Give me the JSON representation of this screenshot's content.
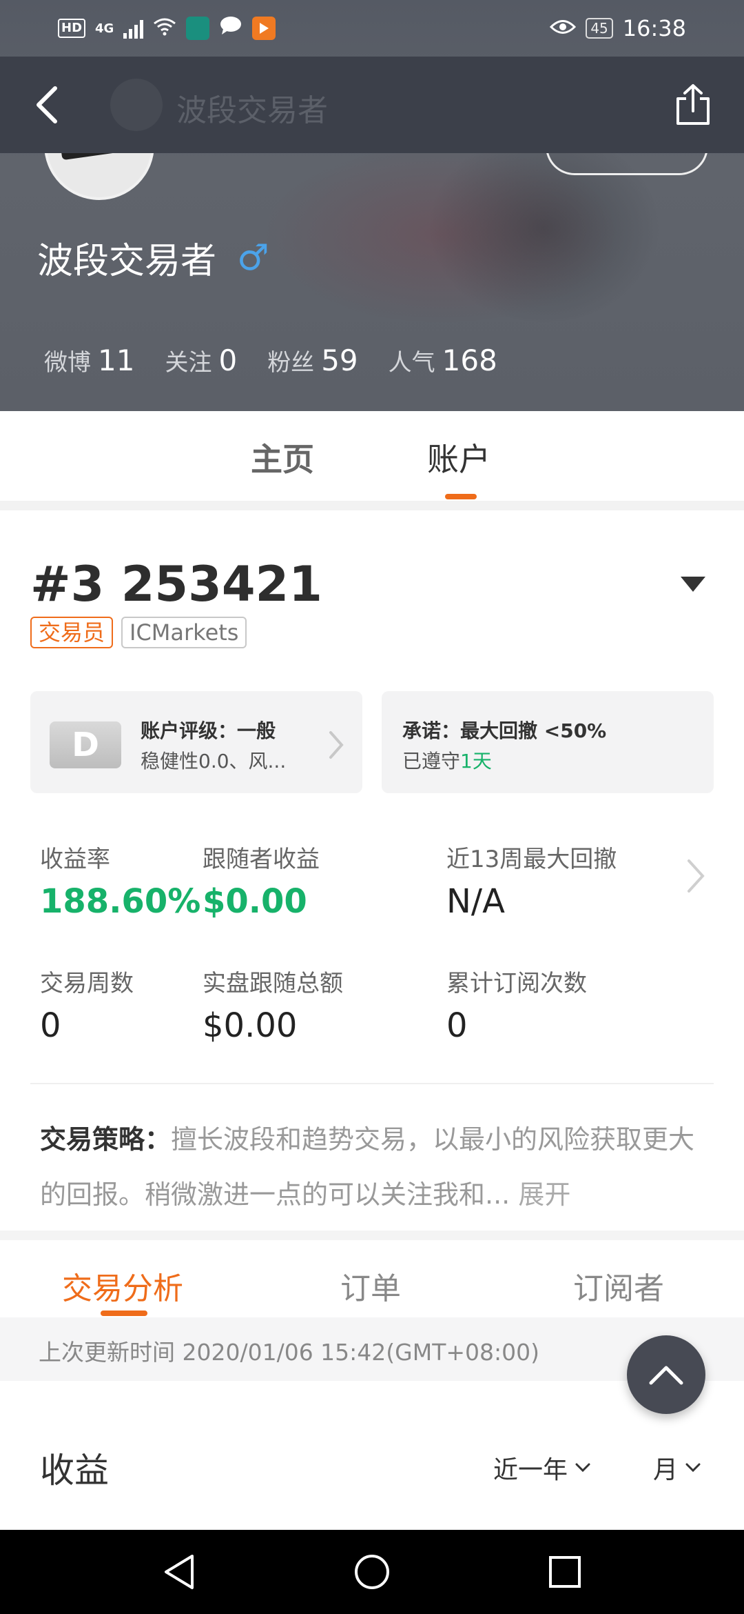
{
  "status_bar": {
    "hd": "HD",
    "network": "4G",
    "time": "16:38",
    "battery": "45"
  },
  "topbar": {
    "title": "波段交易者"
  },
  "profile": {
    "name": "波段交易者",
    "gender_symbol": "♂",
    "stats": [
      {
        "label": "微博",
        "value": "11"
      },
      {
        "label": "关注",
        "value": "0"
      },
      {
        "label": "粉丝",
        "value": "59"
      },
      {
        "label": "人气",
        "value": "168"
      }
    ]
  },
  "profile_tabs": {
    "home": "主页",
    "account": "账户"
  },
  "account": {
    "number": "#3 253421",
    "role_badge": "交易员",
    "broker_badge": "ICMarkets",
    "rating_card": {
      "grade": "D",
      "title": "账户评级：一般",
      "subtitle": "稳健性0.0、风..."
    },
    "promise_card": {
      "title": "承诺：最大回撤 <50%",
      "subtitle_prefix": "已遵守",
      "subtitle_value": "1天"
    },
    "metrics": [
      {
        "label": "收益率",
        "value": "188.60%"
      },
      {
        "label": "跟随者收益",
        "value": "$0.00"
      },
      {
        "label": "近13周最大回撤",
        "value": "N/A"
      },
      {
        "label": "交易周数",
        "value": "0"
      },
      {
        "label": "实盘跟随总额",
        "value": "$0.00"
      },
      {
        "label": "累计订阅次数",
        "value": "0"
      }
    ],
    "strategy": {
      "key": "交易策略：",
      "text": "擅长波段和趋势交易，以最小的风险获取更大的回报。稍微激进一点的可以关注我和...",
      "expand": "展开"
    }
  },
  "sub_tabs": [
    "交易分析",
    "订单",
    "订阅者"
  ],
  "update_text": "上次更新时间 2020/01/06 15:42(GMT+08:00)",
  "earnings": {
    "title": "收益",
    "range": "近一年",
    "period": "月"
  },
  "colors": {
    "accent": "#ef6c1a",
    "positive": "#17b26a",
    "header": "#3c404a"
  }
}
